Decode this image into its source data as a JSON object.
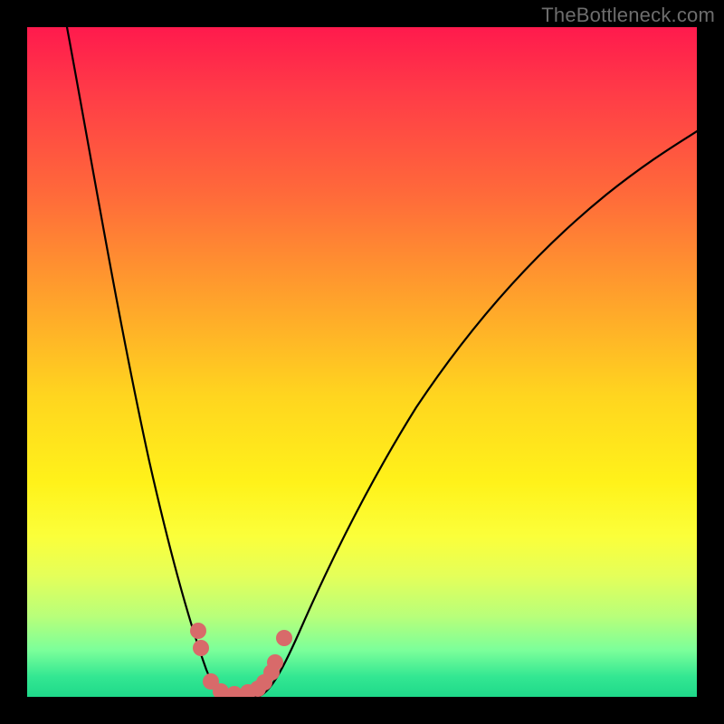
{
  "watermark": "TheBottleneck.com",
  "chart_data": {
    "type": "line",
    "title": "",
    "xlabel": "",
    "ylabel": "",
    "xlim": [
      0,
      100
    ],
    "ylim": [
      0,
      100
    ],
    "background_gradient": {
      "top_color": "#ff1a4d",
      "bottom_color": "#1fd98a",
      "meaning": "top = high bottleneck (red), bottom = low bottleneck (green)"
    },
    "series": [
      {
        "name": "bottleneck-curve-left",
        "x": [
          6,
          8,
          10,
          12,
          14,
          16,
          18,
          20,
          22,
          24,
          26,
          27,
          28
        ],
        "values": [
          100,
          93,
          84,
          74,
          63,
          52,
          41,
          30,
          20,
          12,
          5,
          2,
          0
        ]
      },
      {
        "name": "bottleneck-curve-right",
        "x": [
          34,
          36,
          38,
          40,
          44,
          48,
          52,
          56,
          60,
          66,
          72,
          80,
          88,
          96,
          100
        ],
        "values": [
          0,
          3,
          7,
          11,
          20,
          28,
          35,
          42,
          48,
          56,
          63,
          70,
          77,
          82,
          85
        ]
      },
      {
        "name": "flat-minimum",
        "x": [
          28,
          30,
          32,
          34
        ],
        "values": [
          0,
          0,
          0,
          0
        ]
      }
    ],
    "markers": {
      "name": "sample-points",
      "color": "#d86a6a",
      "radius_category": "large",
      "points": [
        {
          "x": 25.0,
          "y": 9.5
        },
        {
          "x": 25.5,
          "y": 7.0
        },
        {
          "x": 27.0,
          "y": 2.0
        },
        {
          "x": 28.5,
          "y": 0.5
        },
        {
          "x": 30.5,
          "y": 0.2
        },
        {
          "x": 32.5,
          "y": 0.5
        },
        {
          "x": 34.0,
          "y": 1.0
        },
        {
          "x": 35.0,
          "y": 2.0
        },
        {
          "x": 36.0,
          "y": 3.5
        },
        {
          "x": 36.5,
          "y": 5.0
        },
        {
          "x": 38.0,
          "y": 8.5
        }
      ]
    }
  }
}
